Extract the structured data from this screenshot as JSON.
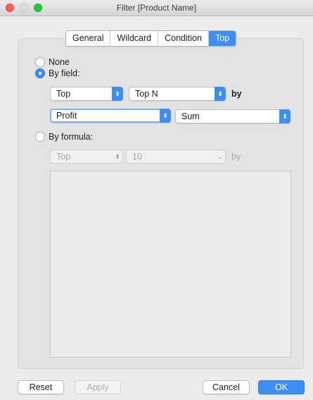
{
  "window": {
    "title": "Filter [Product Name]"
  },
  "tabs": [
    {
      "label": "General",
      "active": false
    },
    {
      "label": "Wildcard",
      "active": false
    },
    {
      "label": "Condition",
      "active": false
    },
    {
      "label": "Top",
      "active": true
    }
  ],
  "options": {
    "none_label": "None",
    "by_field_label": "By field:",
    "by_formula_label": "By formula:",
    "selected": "By field:"
  },
  "by_field": {
    "direction": "Top",
    "count": "Top N",
    "by_word": "by",
    "field": "Profit",
    "aggregation": "Sum"
  },
  "by_formula": {
    "direction": "Top",
    "count": "10",
    "by_word": "by"
  },
  "buttons": {
    "reset": "Reset",
    "apply": "Apply",
    "cancel": "Cancel",
    "ok": "OK"
  },
  "colors": {
    "accent": "#3e8ef7",
    "close": "#ff5f57",
    "maximize": "#28c840"
  }
}
